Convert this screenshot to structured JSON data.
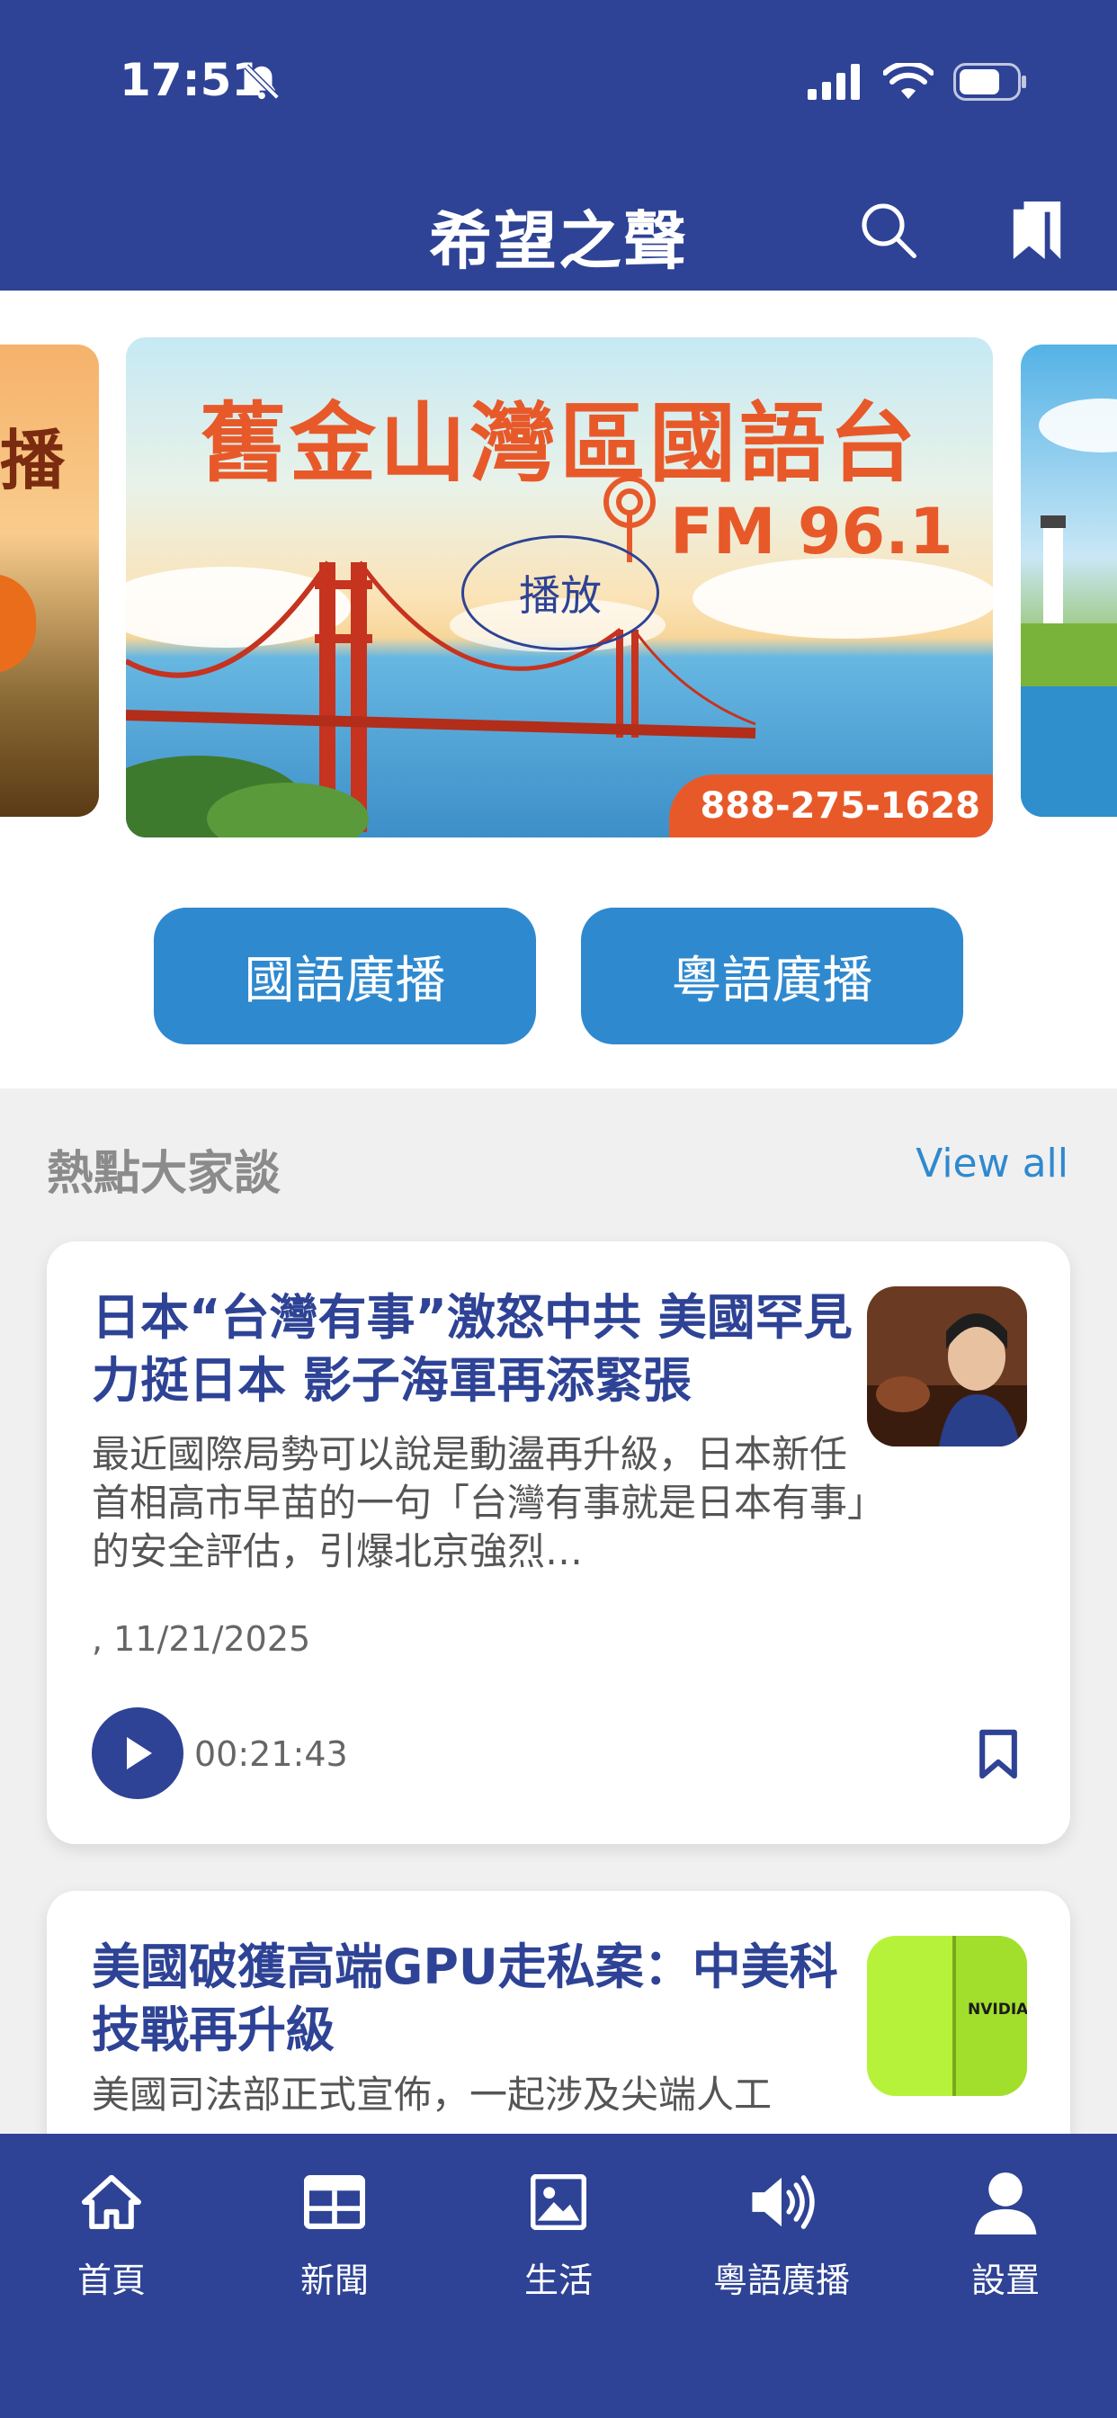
{
  "status_bar": {
    "time": "17:51"
  },
  "header": {
    "title": "希望之聲"
  },
  "banner": {
    "slide_left_text": "播",
    "radio_title": "舊金山灣區國語台",
    "fm": "FM 96.1",
    "phone": "888-275-1628",
    "play_label": "播放"
  },
  "buttons": {
    "mandarin": "國語廣播",
    "cantonese": "粵語廣播"
  },
  "section": {
    "title": "熱點大家談",
    "view_all": "View all"
  },
  "cards": [
    {
      "title": "日本“台灣有事”激怒中共 美國罕見力挺日本 影子海軍再添緊張",
      "excerpt": "最近國際局勢可以說是動盪再升級，日本新任首相高市早苗的一句「台灣有事就是日本有事」的安全評估，引爆北京強烈…",
      "date": ", 11/21/2025",
      "duration": "00:21:43"
    },
    {
      "title": "美國破獲高端GPU走私案：中美科技戰再升級",
      "excerpt": "美國司法部正式宣佈，一起涉及尖端人工",
      "thumb_text": "NVIDIA."
    }
  ],
  "tabs": [
    {
      "label": "首頁",
      "icon": "home-icon"
    },
    {
      "label": "新聞",
      "icon": "newspaper-icon"
    },
    {
      "label": "生活",
      "icon": "image-icon"
    },
    {
      "label": "粵語廣播",
      "icon": "speaker-icon"
    },
    {
      "label": "設置",
      "icon": "user-icon"
    }
  ],
  "colors": {
    "primary": "#2e4395",
    "accent": "#2f89cf",
    "banner_orange": "#e8592a"
  }
}
